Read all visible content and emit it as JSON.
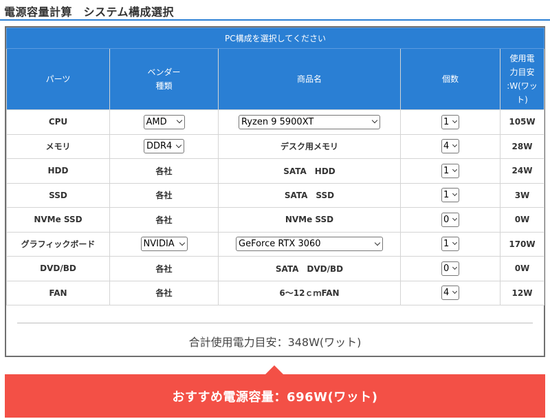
{
  "page": {
    "title": "電源容量計算　システム構成選択"
  },
  "table": {
    "caption": "PC構成を選択してください",
    "headers": {
      "parts": "パーツ",
      "vendor": "ベンダー\n種類",
      "product": "商品名",
      "count": "個数",
      "watt": "使用電\n力目安\n:W(ワッ\nト)"
    },
    "rows": [
      {
        "part": "CPU",
        "vendor": "AMD",
        "vendor_select": true,
        "product": "Ryzen 9 5900XT",
        "product_select": true,
        "count": "1",
        "watt": "105W"
      },
      {
        "part": "メモリ",
        "vendor": "DDR4",
        "vendor_select": true,
        "product": "デスク用メモリ",
        "product_select": false,
        "count": "4",
        "watt": "28W"
      },
      {
        "part": "HDD",
        "vendor": "各社",
        "vendor_select": false,
        "product": "SATA　HDD",
        "product_select": false,
        "count": "1",
        "watt": "24W"
      },
      {
        "part": "SSD",
        "vendor": "各社",
        "vendor_select": false,
        "product": "SATA　SSD",
        "product_select": false,
        "count": "1",
        "watt": "3W"
      },
      {
        "part": "NVMe SSD",
        "vendor": "各社",
        "vendor_select": false,
        "product": "NVMe SSD",
        "product_select": false,
        "count": "0",
        "watt": "0W"
      },
      {
        "part": "グラフィックボード",
        "vendor": "NVIDIA",
        "vendor_select": true,
        "product": "GeForce RTX 3060",
        "product_select": true,
        "count": "1",
        "watt": "170W"
      },
      {
        "part": "DVD/BD",
        "vendor": "各社",
        "vendor_select": false,
        "product": "SATA　DVD/BD",
        "product_select": false,
        "count": "0",
        "watt": "0W"
      },
      {
        "part": "FAN",
        "vendor": "各社",
        "vendor_select": false,
        "product": "6～12ｃｍFAN",
        "product_select": false,
        "count": "4",
        "watt": "12W"
      }
    ]
  },
  "summary": {
    "total": "合計使用電力目安：348W(ワット)",
    "recommend": "おすすめ電源容量：696W(ワット)"
  },
  "colors": {
    "accent_blue": "#2a7fd4",
    "recommend_red": "#f35046"
  },
  "icons": {
    "dropdown": "chevron-down-icon"
  }
}
